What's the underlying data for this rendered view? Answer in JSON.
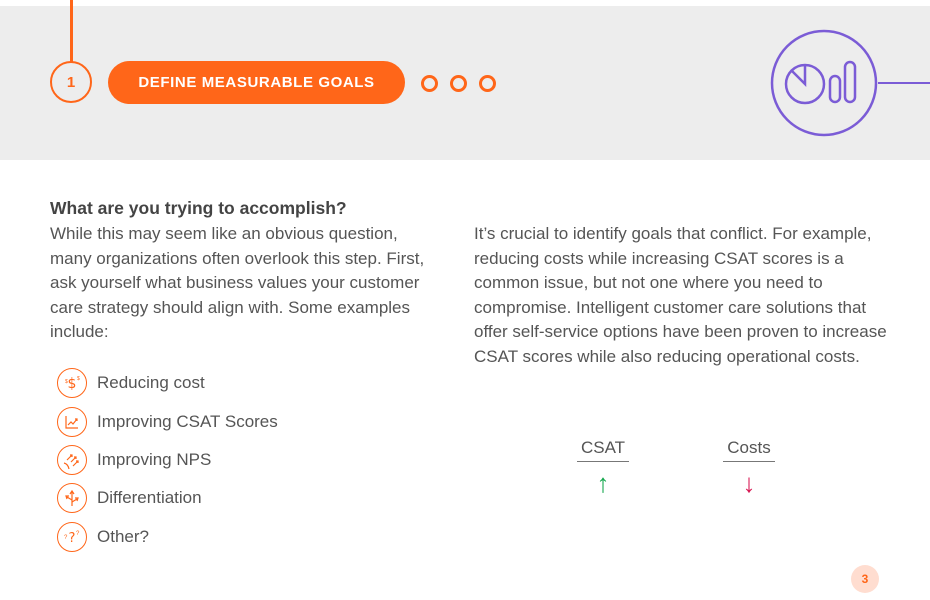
{
  "header": {
    "step_number": "1",
    "step_title": "DEFINE MEASURABLE GOALS",
    "progress_dots": 3,
    "header_icon": "chart-icon"
  },
  "section": {
    "question": "What are you trying to accomplish?",
    "intro": "While this may seem like an obvious question, many organizations often overlook this step. First, ask yourself what business values your customer care strategy should align with. Some examples include:",
    "goals": [
      {
        "icon": "dollar-icon",
        "label": "Reducing cost"
      },
      {
        "icon": "trend-chart-icon",
        "label": "Improving CSAT Scores"
      },
      {
        "icon": "arrows-growth-icon",
        "label": "Improving NPS"
      },
      {
        "icon": "split-arrows-icon",
        "label": "Differentiation"
      },
      {
        "icon": "question-icon",
        "label": "Other?"
      }
    ],
    "conflict_text": "It’s crucial to identify goals that conflict. For example, reducing costs while increasing CSAT scores is a common issue, but not one where you need to compromise. Intelligent customer care solutions that offer self-service options have been proven to increase CSAT scores while also reducing operational costs.",
    "metrics": [
      {
        "label": "CSAT",
        "arrow": "↑",
        "direction": "up",
        "color": "#17a84f"
      },
      {
        "label": "Costs",
        "arrow": "↓",
        "direction": "down",
        "color": "#d81b55"
      }
    ]
  },
  "colors": {
    "accent": "#ff6619",
    "purple": "#7b5cd6",
    "band": "#ededed"
  },
  "page_number": "3"
}
